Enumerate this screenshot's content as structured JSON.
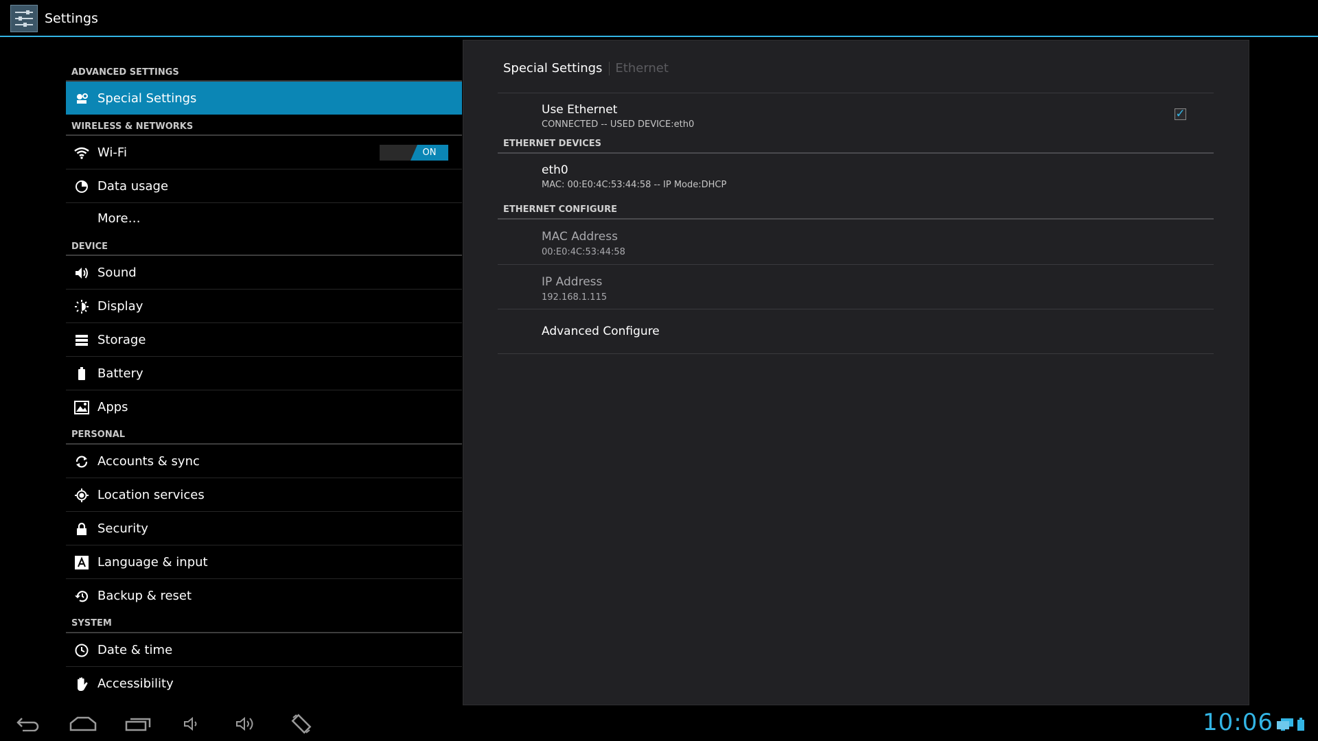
{
  "app": {
    "title": "Settings",
    "icon": "settings-app-icon"
  },
  "sidebar": {
    "sections": [
      {
        "header": "ADVANCED SETTINGS",
        "items": [
          {
            "label": "Special Settings",
            "icon": "special-settings-icon",
            "selected": true
          }
        ]
      },
      {
        "header": "WIRELESS & NETWORKS",
        "items": [
          {
            "label": "Wi-Fi",
            "icon": "wifi-icon",
            "toggle": "ON"
          },
          {
            "label": "Data usage",
            "icon": "data-usage-icon"
          },
          {
            "label": "More…",
            "icon": ""
          }
        ]
      },
      {
        "header": "DEVICE",
        "items": [
          {
            "label": "Sound",
            "icon": "sound-icon"
          },
          {
            "label": "Display",
            "icon": "display-icon"
          },
          {
            "label": "Storage",
            "icon": "storage-icon"
          },
          {
            "label": "Battery",
            "icon": "battery-icon"
          },
          {
            "label": "Apps",
            "icon": "apps-icon"
          }
        ]
      },
      {
        "header": "PERSONAL",
        "items": [
          {
            "label": "Accounts & sync",
            "icon": "sync-icon"
          },
          {
            "label": "Location services",
            "icon": "location-icon"
          },
          {
            "label": "Security",
            "icon": "lock-icon"
          },
          {
            "label": "Language & input",
            "icon": "language-icon"
          },
          {
            "label": "Backup & reset",
            "icon": "backup-icon"
          }
        ]
      },
      {
        "header": "SYSTEM",
        "items": [
          {
            "label": "Date & time",
            "icon": "clock-icon"
          },
          {
            "label": "Accessibility",
            "icon": "accessibility-icon"
          }
        ]
      }
    ]
  },
  "main": {
    "breadcrumb": {
      "current": "Special Settings",
      "sub": "Ethernet"
    },
    "use_ethernet": {
      "title": "Use Ethernet",
      "summary": "CONNECTED -- USED DEVICE:eth0",
      "checked": true
    },
    "devices_header": "ETHERNET DEVICES",
    "device": {
      "title": "eth0",
      "summary": "MAC: 00:E0:4C:53:44:58 -- IP Mode:DHCP"
    },
    "configure_header": "ETHERNET CONFIGURE",
    "mac": {
      "title": "MAC Address",
      "value": "00:E0:4C:53:44:58"
    },
    "ip": {
      "title": "IP Address",
      "value": "192.168.1.115"
    },
    "advanced": {
      "title": "Advanced Configure"
    }
  },
  "navbar": {
    "buttons": [
      "back-icon",
      "home-icon",
      "recent-apps-icon",
      "volume-down-icon",
      "volume-up-icon",
      "rotate-icon"
    ],
    "clock": "10:06",
    "status_icons": [
      "ethernet-icon",
      "battery-icon"
    ]
  },
  "colors": {
    "accent": "#33b5e5",
    "selected": "#0b86b5",
    "panel": "#212124"
  }
}
